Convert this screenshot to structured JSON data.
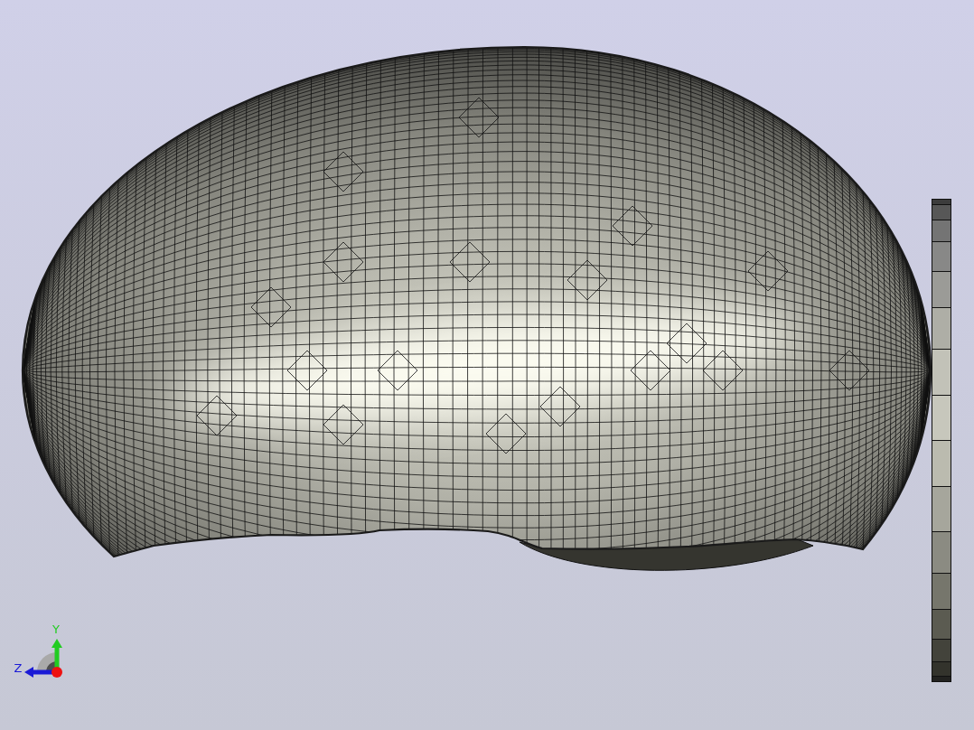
{
  "axis_triad": {
    "y_label": "Y",
    "z_label": "Z"
  },
  "legend": {
    "bands": [
      {
        "color": "#3c3c3c"
      },
      {
        "color": "#575757"
      },
      {
        "color": "#747474"
      },
      {
        "color": "#888887"
      },
      {
        "color": "#9b9b97"
      },
      {
        "color": "#aeaea6"
      },
      {
        "color": "#c2c2b8"
      },
      {
        "color": "#c7c7bc"
      },
      {
        "color": "#bbbbaf"
      },
      {
        "color": "#a6a69c"
      },
      {
        "color": "#8b8b82"
      },
      {
        "color": "#76766c"
      },
      {
        "color": "#5b5b51"
      },
      {
        "color": "#43433b"
      },
      {
        "color": "#33332c"
      },
      {
        "color": "#222220"
      }
    ]
  }
}
